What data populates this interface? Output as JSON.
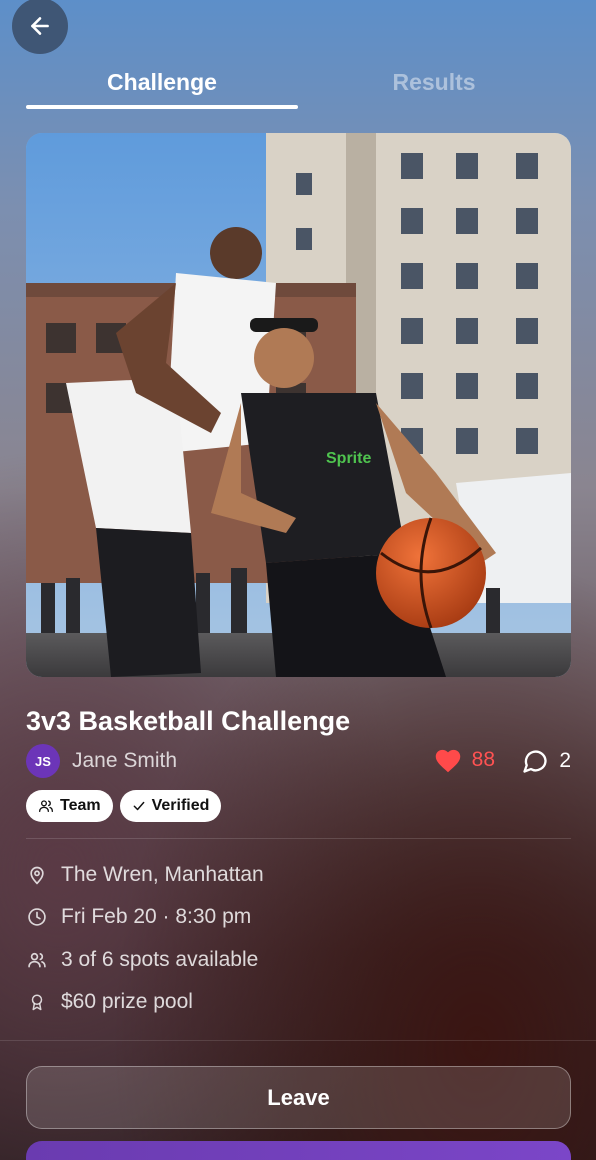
{
  "nav": {
    "back_icon": "arrow-left-icon"
  },
  "tabs": [
    {
      "label": "Challenge",
      "active": true
    },
    {
      "label": "Results",
      "active": false
    }
  ],
  "event": {
    "title": "3v3 Basketball Challenge",
    "host": {
      "initials": "JS",
      "name": "Jane Smith",
      "avatar_color": "#6c35b8"
    },
    "likes": "88",
    "comments": "2",
    "tags": [
      {
        "label": "Team",
        "icon": "users-icon"
      },
      {
        "label": "Verified",
        "icon": "check-icon"
      }
    ],
    "details": [
      {
        "icon": "map-pin-icon",
        "text": "The Wren, Manhattan"
      },
      {
        "icon": "clock-icon",
        "text": "Fri Feb 20 · 8:30 pm"
      },
      {
        "icon": "users-icon",
        "text": "3 of 6 spots available"
      },
      {
        "icon": "award-icon",
        "text": "$60 prize pool"
      }
    ]
  },
  "actions": {
    "leave_label": "Leave"
  },
  "colors": {
    "accent": "#7b46c8",
    "like": "#ff5252"
  }
}
